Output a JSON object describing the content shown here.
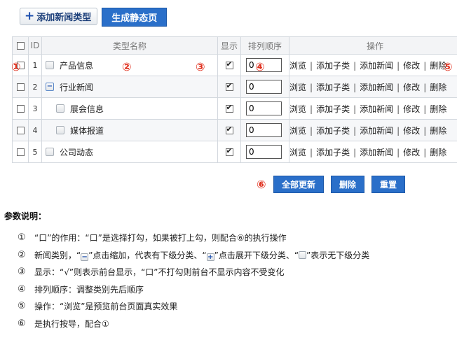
{
  "toolbar": {
    "add_label": "添加新闻类型",
    "generate_label": "生成静态页"
  },
  "table": {
    "headers": {
      "select": "",
      "id": "ID",
      "name": "类型名称",
      "show": "显示",
      "order": "排列顺序",
      "ops": "操作"
    },
    "rows": [
      {
        "id": "1",
        "name": "产品信息",
        "icon": "leaf-icon",
        "indent": 0,
        "checked": true,
        "order": "0"
      },
      {
        "id": "2",
        "name": "行业新闻",
        "icon": "collapse-icon",
        "indent": 0,
        "checked": true,
        "order": "0"
      },
      {
        "id": "3",
        "name": "展会信息",
        "icon": "leaf-icon",
        "indent": 1,
        "checked": true,
        "order": "0"
      },
      {
        "id": "4",
        "name": "媒体报道",
        "icon": "leaf-icon",
        "indent": 1,
        "checked": true,
        "order": "0"
      },
      {
        "id": "5",
        "name": "公司动态",
        "icon": "leaf-icon",
        "indent": 0,
        "checked": true,
        "order": "0"
      }
    ],
    "ops": {
      "browse": "浏览",
      "add_sub": "添加子类",
      "add_news": "添加新闻",
      "edit": "修改",
      "delete": "删除",
      "sep": "|"
    }
  },
  "markers": {
    "m1": "①",
    "m2": "②",
    "m3": "③",
    "m4": "④",
    "m5": "⑤",
    "m6": "⑥"
  },
  "actions": {
    "update_all": "全部更新",
    "delete": "删除",
    "reset": "重置"
  },
  "notes": {
    "title": "参数说明：",
    "items": [
      {
        "num": "①",
        "text": "“口”的作用：“口”是选择打勾，如果被打上勾，则配合⑥的执行操作"
      },
      {
        "num": "②",
        "pre": "新闻类别，“",
        "mid1": "”点击缩加，代表有下级分类、“",
        "mid2": "”点击展开下级分类、“",
        "post": "”表示无下级分类"
      },
      {
        "num": "③",
        "text": "显示：“√”则表示前台显示，“口”不打勾则前台不显示内容不受变化"
      },
      {
        "num": "④",
        "text": "排列顺序：调整类别先后顺序"
      },
      {
        "num": "⑤",
        "text": "操作：“浏览”是预览前台页面真实效果"
      },
      {
        "num": "⑥",
        "text": "是执行按导，配合①"
      }
    ]
  },
  "colors": {
    "accent": "#2a6fc9",
    "marker": "#e0301e"
  }
}
